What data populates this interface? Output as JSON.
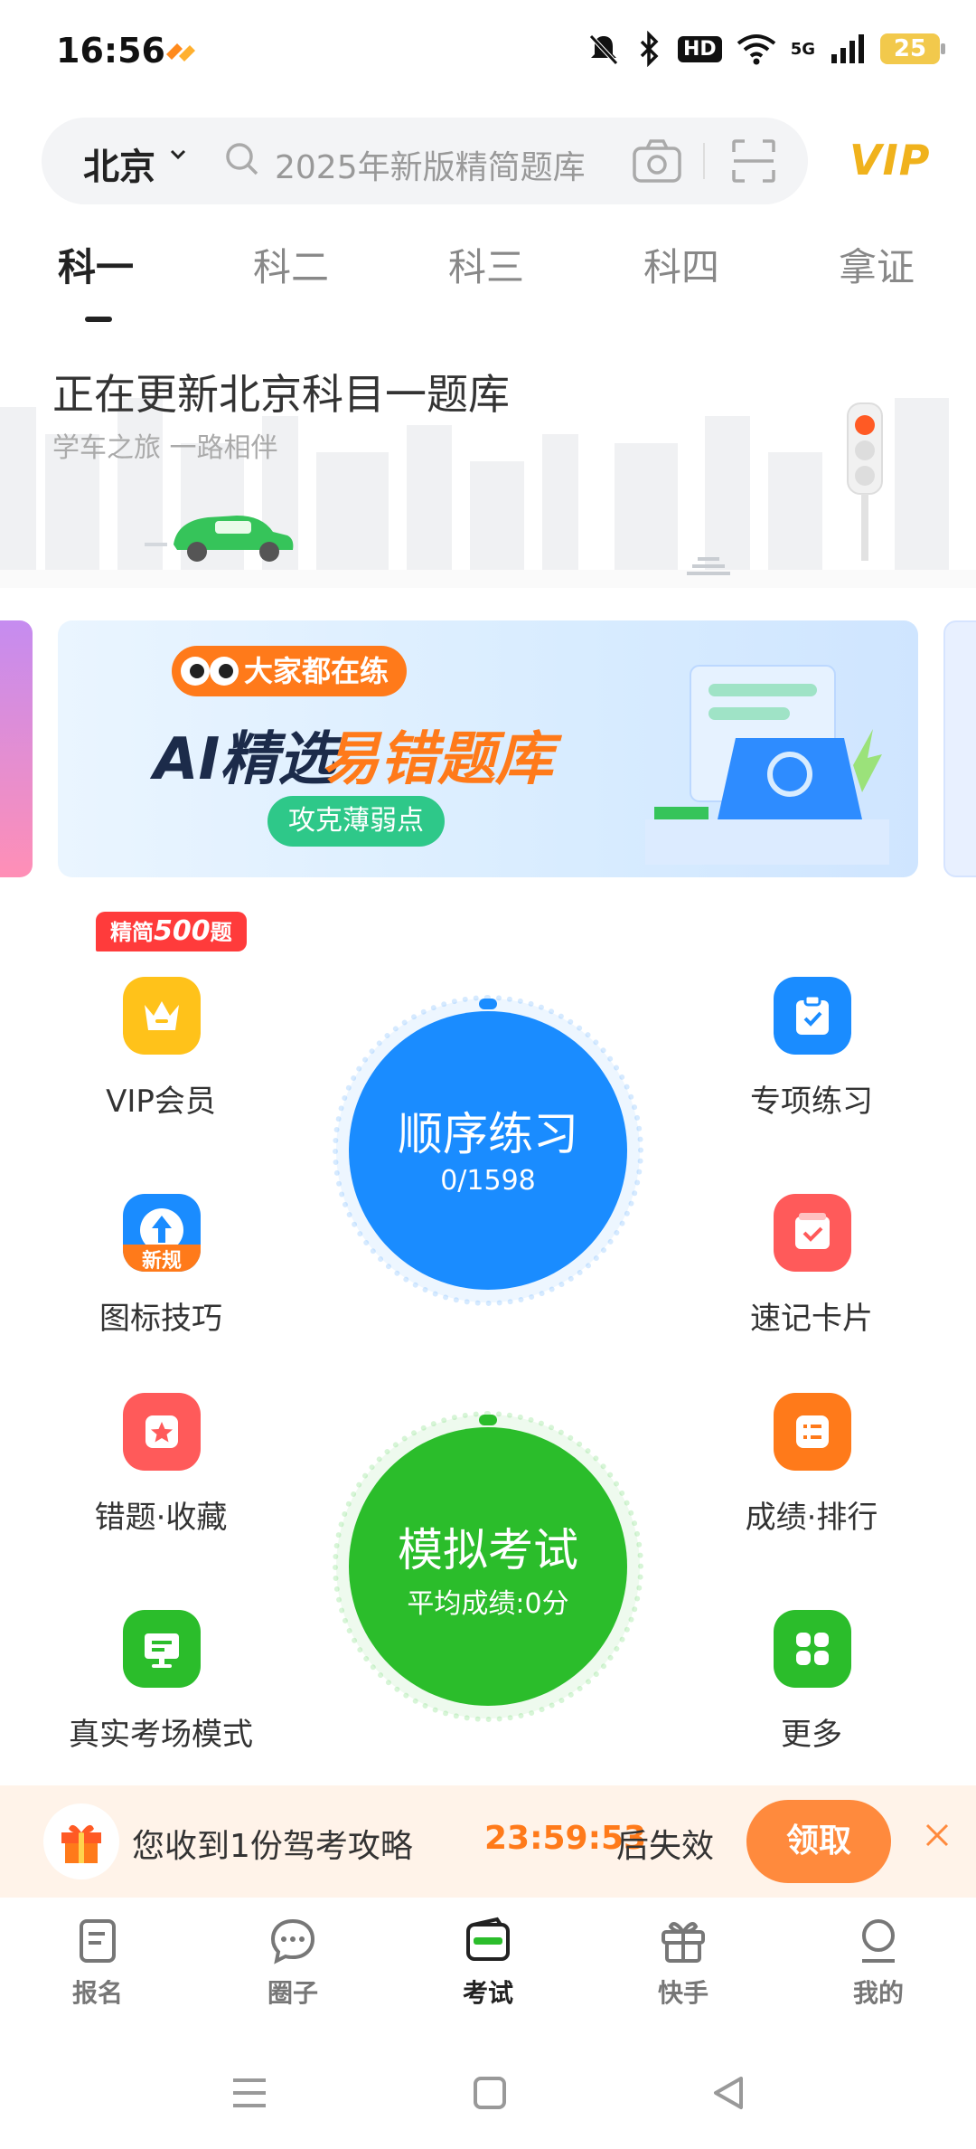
{
  "status_bar": {
    "time": "16:56",
    "signal_label": "5G",
    "hd_label": "HD",
    "battery": "25"
  },
  "header": {
    "city": "北京",
    "search_placeholder": "2025年新版精简题库",
    "vip_label": "VIP"
  },
  "tabs": [
    {
      "label": "科一",
      "active": true
    },
    {
      "label": "科二",
      "active": false
    },
    {
      "label": "科三",
      "active": false
    },
    {
      "label": "科四",
      "active": false
    },
    {
      "label": "拿证",
      "active": false
    }
  ],
  "hero": {
    "title": "正在更新北京科目一题库",
    "subtitle": "学车之旅 一路相伴"
  },
  "banner": {
    "pill": "大家都在练",
    "title_ai": "AI精选",
    "title_main": "易错题库",
    "button": "攻克薄弱点"
  },
  "grid": {
    "vip_badge_prefix": "精简",
    "vip_badge_count": "500",
    "vip_badge_suffix": "题",
    "vip": "VIP会员",
    "special_practice": "专项练习",
    "sign_tips": "图标技巧",
    "new_rule_tag": "新规",
    "flash_cards": "速记卡片",
    "mistakes_favorites": "错题·收藏",
    "scores_ranking": "成绩·排行",
    "real_exam_mode": "真实考场模式",
    "more": "更多"
  },
  "sequential_practice": {
    "title": "顺序练习",
    "progress": "0/1598"
  },
  "mock_exam": {
    "title": "模拟考试",
    "average": "平均成绩:0分"
  },
  "promo": {
    "text": "您收到1份驾考攻略",
    "countdown": "23:59:53",
    "suffix": "后失效",
    "button": "领取"
  },
  "bottom_nav": [
    {
      "label": "报名",
      "active": false
    },
    {
      "label": "圈子",
      "active": false
    },
    {
      "label": "考试",
      "active": true
    },
    {
      "label": "快手",
      "active": false
    },
    {
      "label": "我的",
      "active": false
    }
  ],
  "colors": {
    "blue": "#1a8cff",
    "green": "#2bbd2b",
    "orange": "#ff7a1a",
    "vip_gold": "#f0b21c"
  }
}
